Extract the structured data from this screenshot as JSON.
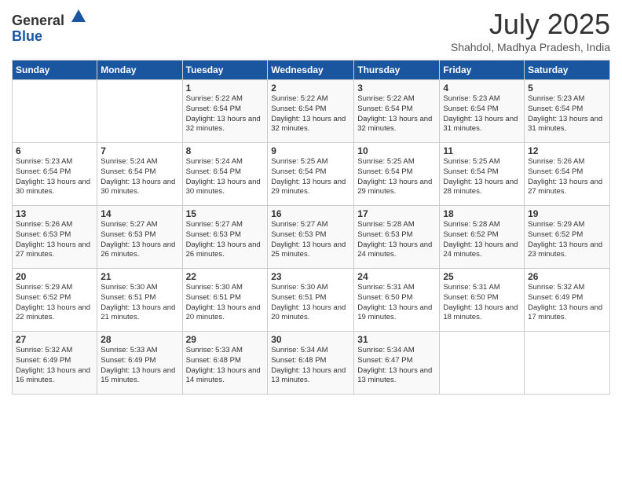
{
  "header": {
    "logo_general": "General",
    "logo_blue": "Blue",
    "month_year": "July 2025",
    "location": "Shahdol, Madhya Pradesh, India"
  },
  "days_of_week": [
    "Sunday",
    "Monday",
    "Tuesday",
    "Wednesday",
    "Thursday",
    "Friday",
    "Saturday"
  ],
  "weeks": [
    [
      {
        "day": "",
        "info": ""
      },
      {
        "day": "",
        "info": ""
      },
      {
        "day": "1",
        "info": "Sunrise: 5:22 AM\nSunset: 6:54 PM\nDaylight: 13 hours and 32 minutes."
      },
      {
        "day": "2",
        "info": "Sunrise: 5:22 AM\nSunset: 6:54 PM\nDaylight: 13 hours and 32 minutes."
      },
      {
        "day": "3",
        "info": "Sunrise: 5:22 AM\nSunset: 6:54 PM\nDaylight: 13 hours and 32 minutes."
      },
      {
        "day": "4",
        "info": "Sunrise: 5:23 AM\nSunset: 6:54 PM\nDaylight: 13 hours and 31 minutes."
      },
      {
        "day": "5",
        "info": "Sunrise: 5:23 AM\nSunset: 6:54 PM\nDaylight: 13 hours and 31 minutes."
      }
    ],
    [
      {
        "day": "6",
        "info": "Sunrise: 5:23 AM\nSunset: 6:54 PM\nDaylight: 13 hours and 30 minutes."
      },
      {
        "day": "7",
        "info": "Sunrise: 5:24 AM\nSunset: 6:54 PM\nDaylight: 13 hours and 30 minutes."
      },
      {
        "day": "8",
        "info": "Sunrise: 5:24 AM\nSunset: 6:54 PM\nDaylight: 13 hours and 30 minutes."
      },
      {
        "day": "9",
        "info": "Sunrise: 5:25 AM\nSunset: 6:54 PM\nDaylight: 13 hours and 29 minutes."
      },
      {
        "day": "10",
        "info": "Sunrise: 5:25 AM\nSunset: 6:54 PM\nDaylight: 13 hours and 29 minutes."
      },
      {
        "day": "11",
        "info": "Sunrise: 5:25 AM\nSunset: 6:54 PM\nDaylight: 13 hours and 28 minutes."
      },
      {
        "day": "12",
        "info": "Sunrise: 5:26 AM\nSunset: 6:54 PM\nDaylight: 13 hours and 27 minutes."
      }
    ],
    [
      {
        "day": "13",
        "info": "Sunrise: 5:26 AM\nSunset: 6:53 PM\nDaylight: 13 hours and 27 minutes."
      },
      {
        "day": "14",
        "info": "Sunrise: 5:27 AM\nSunset: 6:53 PM\nDaylight: 13 hours and 26 minutes."
      },
      {
        "day": "15",
        "info": "Sunrise: 5:27 AM\nSunset: 6:53 PM\nDaylight: 13 hours and 26 minutes."
      },
      {
        "day": "16",
        "info": "Sunrise: 5:27 AM\nSunset: 6:53 PM\nDaylight: 13 hours and 25 minutes."
      },
      {
        "day": "17",
        "info": "Sunrise: 5:28 AM\nSunset: 6:53 PM\nDaylight: 13 hours and 24 minutes."
      },
      {
        "day": "18",
        "info": "Sunrise: 5:28 AM\nSunset: 6:52 PM\nDaylight: 13 hours and 24 minutes."
      },
      {
        "day": "19",
        "info": "Sunrise: 5:29 AM\nSunset: 6:52 PM\nDaylight: 13 hours and 23 minutes."
      }
    ],
    [
      {
        "day": "20",
        "info": "Sunrise: 5:29 AM\nSunset: 6:52 PM\nDaylight: 13 hours and 22 minutes."
      },
      {
        "day": "21",
        "info": "Sunrise: 5:30 AM\nSunset: 6:51 PM\nDaylight: 13 hours and 21 minutes."
      },
      {
        "day": "22",
        "info": "Sunrise: 5:30 AM\nSunset: 6:51 PM\nDaylight: 13 hours and 20 minutes."
      },
      {
        "day": "23",
        "info": "Sunrise: 5:30 AM\nSunset: 6:51 PM\nDaylight: 13 hours and 20 minutes."
      },
      {
        "day": "24",
        "info": "Sunrise: 5:31 AM\nSunset: 6:50 PM\nDaylight: 13 hours and 19 minutes."
      },
      {
        "day": "25",
        "info": "Sunrise: 5:31 AM\nSunset: 6:50 PM\nDaylight: 13 hours and 18 minutes."
      },
      {
        "day": "26",
        "info": "Sunrise: 5:32 AM\nSunset: 6:49 PM\nDaylight: 13 hours and 17 minutes."
      }
    ],
    [
      {
        "day": "27",
        "info": "Sunrise: 5:32 AM\nSunset: 6:49 PM\nDaylight: 13 hours and 16 minutes."
      },
      {
        "day": "28",
        "info": "Sunrise: 5:33 AM\nSunset: 6:49 PM\nDaylight: 13 hours and 15 minutes."
      },
      {
        "day": "29",
        "info": "Sunrise: 5:33 AM\nSunset: 6:48 PM\nDaylight: 13 hours and 14 minutes."
      },
      {
        "day": "30",
        "info": "Sunrise: 5:34 AM\nSunset: 6:48 PM\nDaylight: 13 hours and 13 minutes."
      },
      {
        "day": "31",
        "info": "Sunrise: 5:34 AM\nSunset: 6:47 PM\nDaylight: 13 hours and 13 minutes."
      },
      {
        "day": "",
        "info": ""
      },
      {
        "day": "",
        "info": ""
      }
    ]
  ]
}
